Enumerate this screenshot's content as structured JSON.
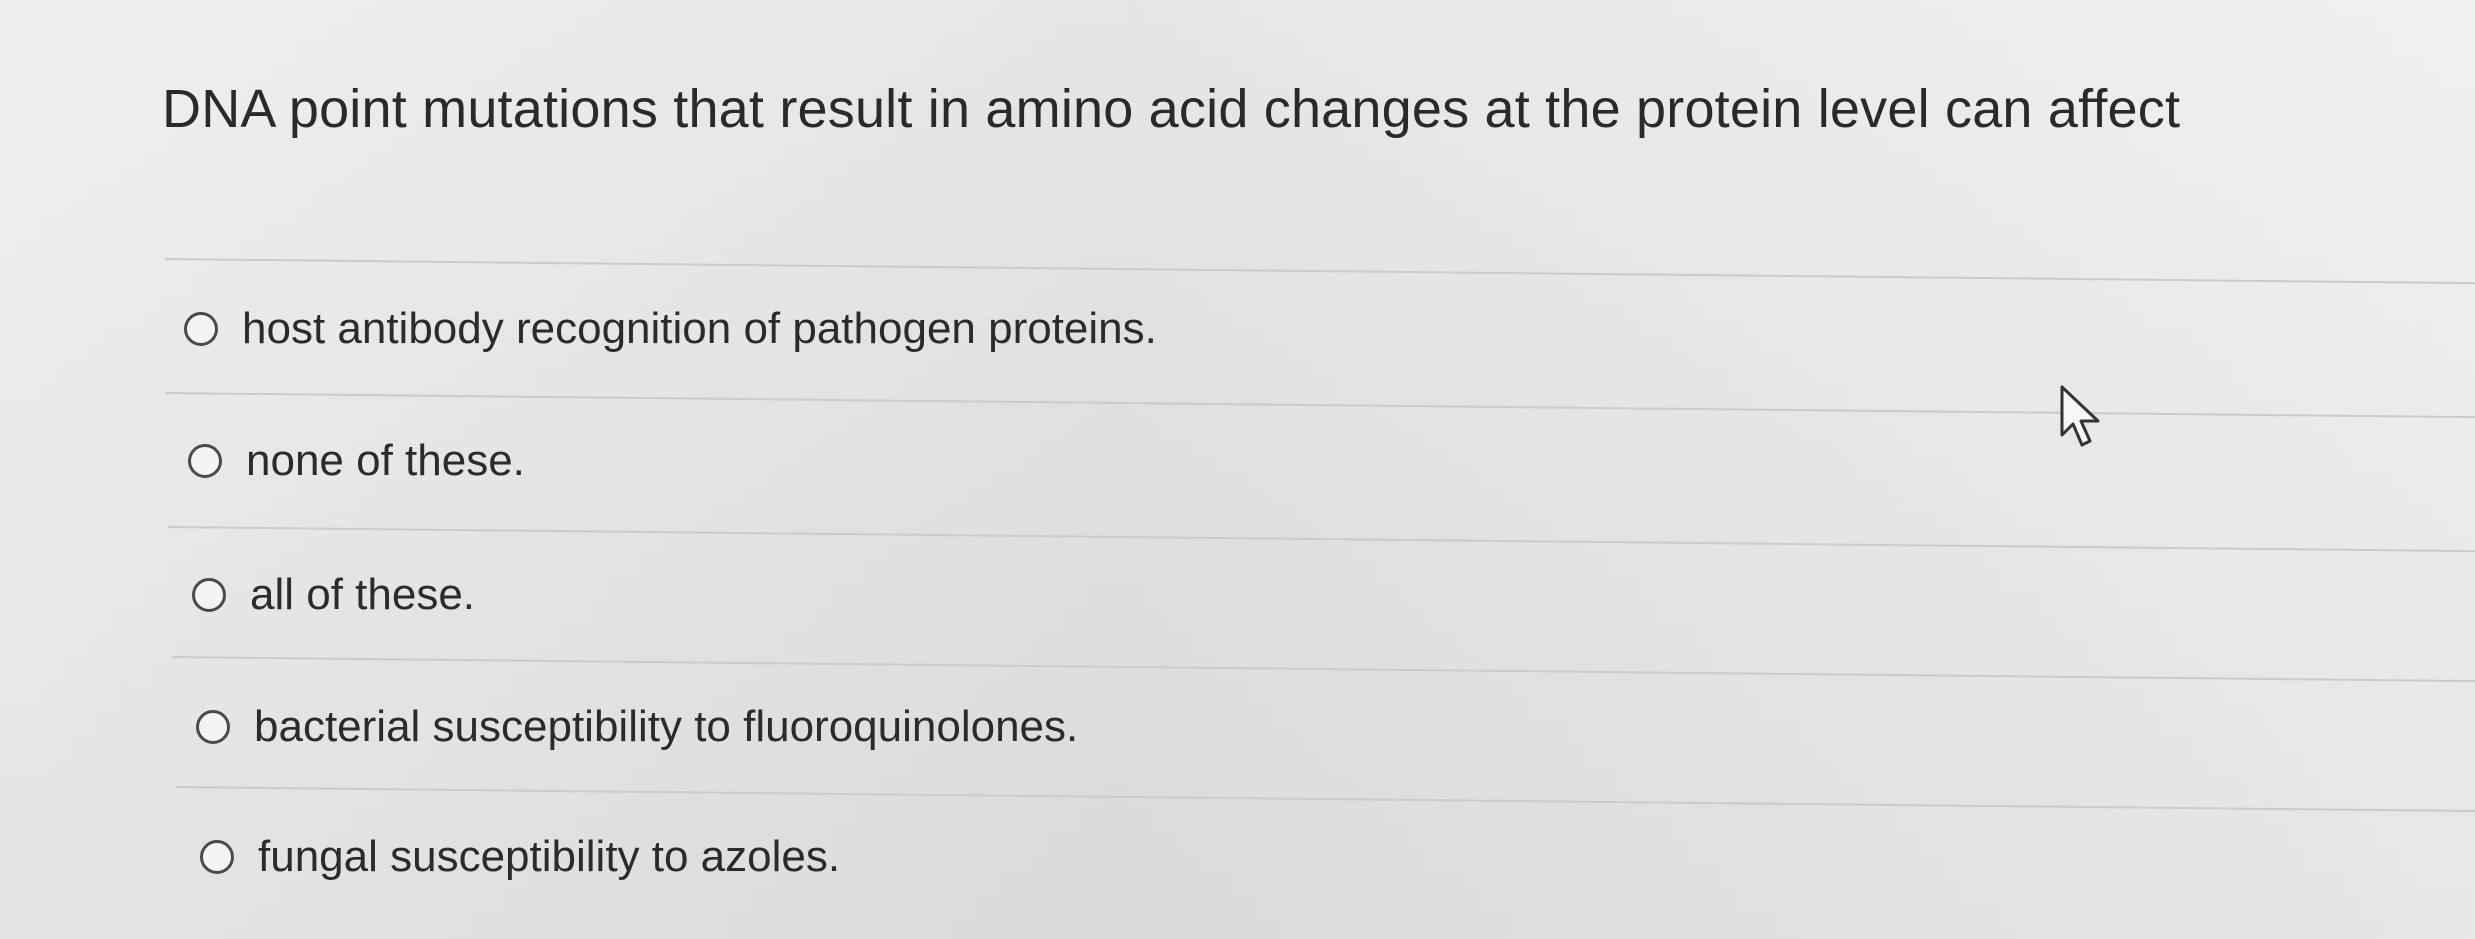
{
  "question": {
    "text": "DNA point mutations that result in amino acid changes at the protein level can affect"
  },
  "options": [
    {
      "label": "host antibody recognition of pathogen proteins.",
      "selected": false
    },
    {
      "label": "none of these.",
      "selected": false
    },
    {
      "label": "all of these.",
      "selected": false
    },
    {
      "label": "bacterial susceptibility to fluoroquinolones.",
      "selected": false
    },
    {
      "label": "fungal susceptibility to azoles.",
      "selected": false
    }
  ],
  "icons": {
    "radio": "radio-unselected-icon",
    "cursor": "mouse-pointer-icon"
  },
  "colors": {
    "background": "#e9eaea",
    "text": "#2b2b2d",
    "divider": "#c9cccb"
  }
}
